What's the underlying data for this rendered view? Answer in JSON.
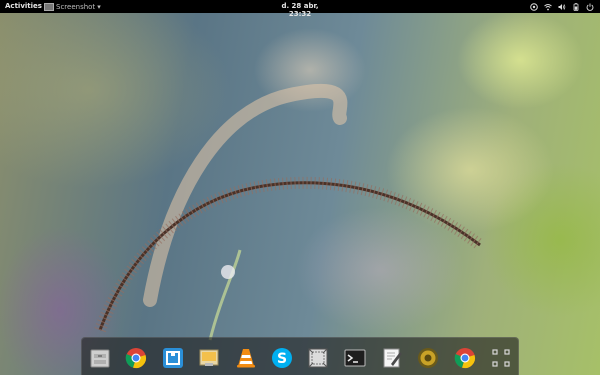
{
  "topbar": {
    "activities": "Activities",
    "app_menu_label": "Screenshot",
    "clock": "d. 28 abr, 23:32"
  },
  "tray": [
    "accessibility-icon",
    "wifi-icon",
    "volume-icon",
    "battery-icon",
    "power-menu-icon"
  ],
  "dock": {
    "items": [
      {
        "name": "files",
        "icon": "file-cabinet-icon"
      },
      {
        "name": "chrome",
        "icon": "chrome-icon"
      },
      {
        "name": "window-app",
        "icon": "window-app-icon"
      },
      {
        "name": "image-viewer",
        "icon": "image-viewer-icon"
      },
      {
        "name": "vlc",
        "icon": "vlc-cone-icon"
      },
      {
        "name": "skype",
        "icon": "skype-icon"
      },
      {
        "name": "screenshot-tool",
        "icon": "screenshot-tool-icon"
      },
      {
        "name": "terminal",
        "icon": "terminal-icon"
      },
      {
        "name": "text-editor",
        "icon": "text-editor-icon"
      },
      {
        "name": "speaker",
        "icon": "speaker-icon"
      },
      {
        "name": "chrome-2",
        "icon": "chrome-icon"
      },
      {
        "name": "show-applications",
        "icon": "app-grid-icon"
      }
    ]
  },
  "colors": {
    "topbar_bg": "#000000",
    "dock_bg": "rgba(30,30,30,0.62)",
    "text": "#e6e6e6"
  }
}
